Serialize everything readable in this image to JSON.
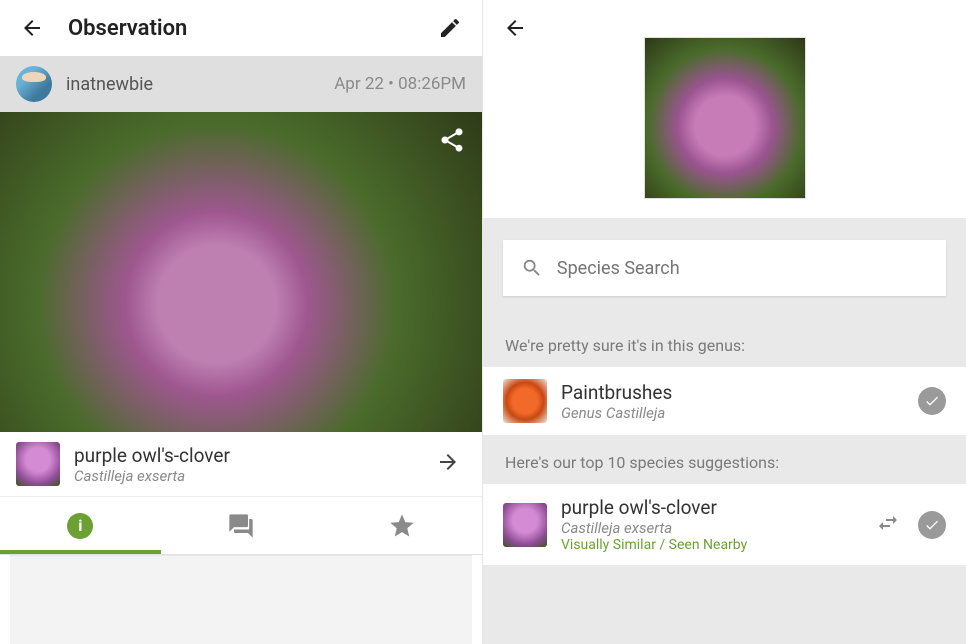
{
  "left": {
    "title": "Observation",
    "user": "inatnewbie",
    "timestamp": "Apr 22 • 08:26PM",
    "species": {
      "common": "purple owl's-clover",
      "scientific": "Castilleja exserta"
    }
  },
  "right": {
    "search_placeholder": "Species Search",
    "genus_heading": "We're pretty sure it's in this genus:",
    "genus_suggestion": {
      "common": "Paintbrushes",
      "scientific": "Genus Castilleja"
    },
    "species_heading": "Here's our top 10 species suggestions:",
    "top_suggestion": {
      "common": "purple owl's-clover",
      "scientific": "Castilleja exserta",
      "tags": "Visually Similar / Seen Nearby"
    }
  }
}
